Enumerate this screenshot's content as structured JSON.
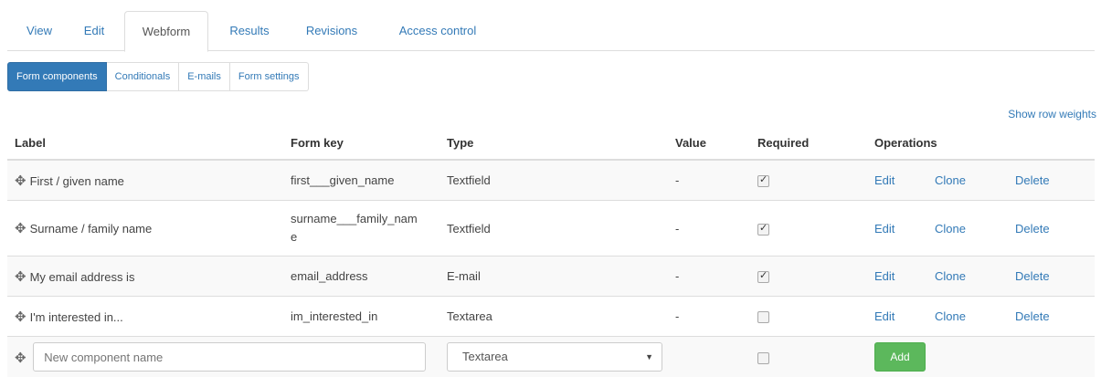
{
  "tabs": [
    {
      "label": "View"
    },
    {
      "label": "Edit"
    },
    {
      "label": "Webform"
    },
    {
      "label": "Results"
    },
    {
      "label": "Revisions"
    },
    {
      "label": "Access control"
    }
  ],
  "subtabs": [
    {
      "label": "Form components"
    },
    {
      "label": "Conditionals"
    },
    {
      "label": "E-mails"
    },
    {
      "label": "Form settings"
    }
  ],
  "show_row_weights": "Show row weights",
  "table": {
    "headers": [
      "Label",
      "Form key",
      "Type",
      "Value",
      "Required",
      "Operations"
    ],
    "rows": [
      {
        "label": "First / given name",
        "key": "first___given_name",
        "type": "Textfield",
        "value": "-",
        "required": true
      },
      {
        "label": "Surname / family name",
        "key": "surname___family_name",
        "type": "Textfield",
        "value": "-",
        "required": true
      },
      {
        "label": "My email address is",
        "key": "email_address",
        "type": "E-mail",
        "value": "-",
        "required": true
      },
      {
        "label": "I'm interested in...",
        "key": "im_interested_in",
        "type": "Textarea",
        "value": "-",
        "required": false
      }
    ],
    "ops": {
      "edit": "Edit",
      "clone": "Clone",
      "delete": "Delete"
    }
  },
  "new_component": {
    "placeholder": "New component name",
    "type_selected": "Textarea",
    "required": false,
    "add_label": "Add"
  },
  "icons": {
    "drag": "drag-handle-icon",
    "select_arrow": "caret-down-icon"
  },
  "colors": {
    "link": "#337ab7",
    "active_tab": "#337ab7",
    "add_button": "#5cb85c"
  }
}
